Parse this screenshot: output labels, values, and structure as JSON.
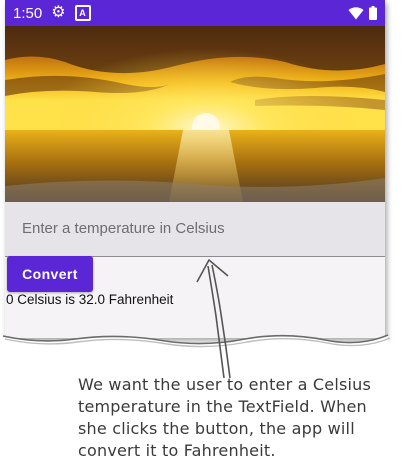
{
  "status_bar": {
    "time": "1:50",
    "icons": [
      "gear-icon",
      "a-icon",
      "wifi-icon",
      "battery-icon"
    ],
    "color": "#5b27d6"
  },
  "hero_image": {
    "subject": "sunset-over-sea"
  },
  "text_field": {
    "placeholder": "Enter a temperature in Celsius",
    "value": ""
  },
  "convert_button": {
    "label": "Convert",
    "color": "#5b27d6"
  },
  "result_text": "0 Celsius is 32.0 Fahrenheit",
  "annotation": {
    "lines": [
      "We want the user to enter a Celsius",
      "temperature in the TextField. When",
      "she clicks the button, the app will",
      "convert it to Fahrenheit."
    ]
  }
}
